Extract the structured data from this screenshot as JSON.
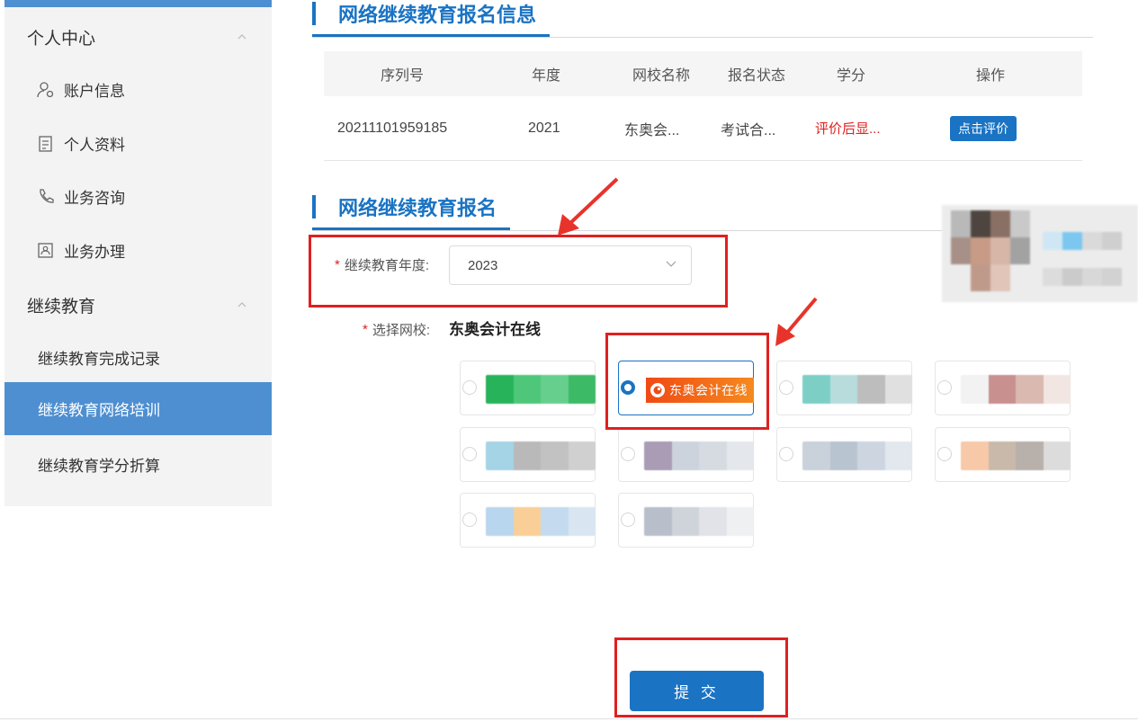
{
  "sidebar": {
    "group_personal": {
      "label": "个人中心"
    },
    "items_personal": [
      {
        "label": "账户信息",
        "icon": "account-user-icon"
      },
      {
        "label": "个人资料",
        "icon": "profile-document-icon"
      },
      {
        "label": "业务咨询",
        "icon": "phone-icon"
      },
      {
        "label": "业务办理",
        "icon": "business-handle-icon"
      }
    ],
    "group_education": {
      "label": "继续教育"
    },
    "items_education": [
      {
        "label": "继续教育完成记录",
        "active": false
      },
      {
        "label": "继续教育网络培训",
        "active": true
      },
      {
        "label": "继续教育学分折算",
        "active": false
      }
    ]
  },
  "info_section": {
    "title": "网络继续教育报名信息",
    "columns": [
      "序列号",
      "年度",
      "网校名称",
      "报名状态",
      "学分",
      "操作"
    ],
    "rows": [
      {
        "serial": "20211101959185",
        "year": "2021",
        "school": "东奥会...",
        "status": "考试合...",
        "credit": "评价后显...",
        "action": "点击评价"
      }
    ]
  },
  "signup_section": {
    "title": "网络继续教育报名",
    "year_label": "继续教育年度:",
    "year_value": "2023",
    "school_label": "选择网校:",
    "school_value": "东奥会计在线",
    "selected_logo_text": "东奥会计在线",
    "submit_label": "提 交"
  },
  "colors": {
    "accent": "#1a73c3",
    "sidebar_active": "#4e8fd1",
    "highlight": "#e02020"
  }
}
